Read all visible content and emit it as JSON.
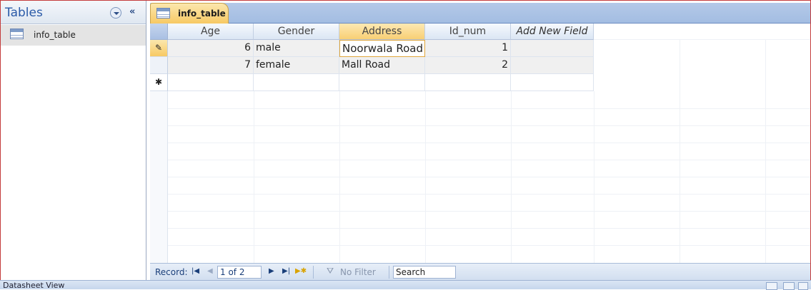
{
  "nav": {
    "title": "Tables",
    "collapse_label": "«",
    "items": [
      {
        "label": "info_table",
        "icon": "table-icon"
      }
    ]
  },
  "tab": {
    "label": "info_table",
    "icon": "table-icon"
  },
  "datasheet": {
    "columns": [
      "Age",
      "Gender",
      "Address",
      "Id_num",
      "Add New Field"
    ],
    "rows": [
      {
        "selector": "✎",
        "age": "6",
        "gender": "male",
        "address": "Noorwala Road",
        "id_num": "1"
      },
      {
        "selector": "",
        "age": "7",
        "gender": "female",
        "address": "Mall Road",
        "id_num": "2"
      }
    ],
    "new_row_selector": "✱"
  },
  "record_nav": {
    "label": "Record:",
    "first_icon": "first-record-icon",
    "prev_icon": "previous-record-icon",
    "position": "1 of 2",
    "next_icon": "next-record-icon",
    "last_icon": "last-record-icon",
    "new_icon": "new-record-icon",
    "filter_label": "No Filter",
    "search_value": "Search"
  },
  "status": {
    "text": "Datasheet View"
  },
  "colors": {
    "accent": "#f7c964",
    "title": "#2a5aa8",
    "border": "#c43c3c"
  }
}
